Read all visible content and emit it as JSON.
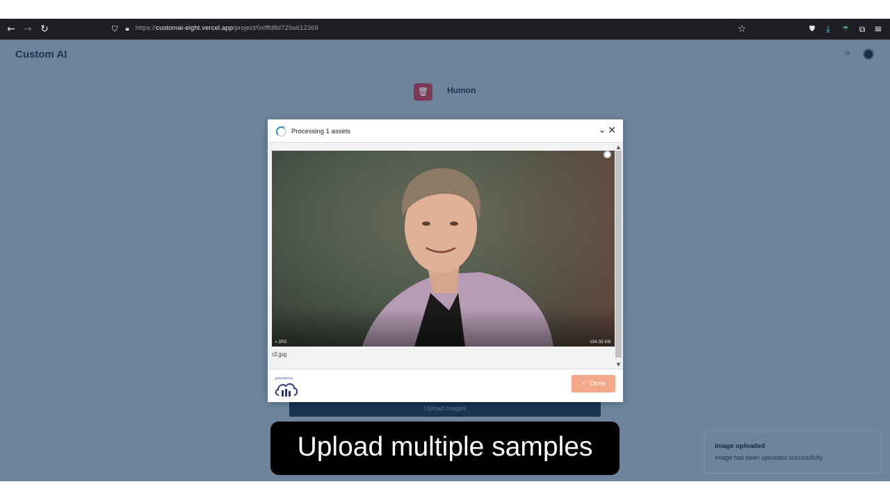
{
  "browser": {
    "url_prefix": "https://",
    "url_host": "customai-eight.vercel.app",
    "url_path": "/project/0xfffd8d729a612369"
  },
  "header": {
    "brand": "Custom AI"
  },
  "project": {
    "name": "Humon",
    "upload_button_label": "Upload Images"
  },
  "modal": {
    "status_text": "Processing 1 assets",
    "file": {
      "type": "JPG",
      "size": "104.05 KB",
      "name": "r2.jpg"
    },
    "footer": {
      "powered_by": "powered by",
      "done_label": "Done"
    }
  },
  "caption": "Upload multiple samples",
  "toast": {
    "title": "Image uploaded",
    "message": "Image has been uploaded successfully"
  },
  "colors": {
    "page_overlay": "#6e849d",
    "brand_text": "#1b3552",
    "done_button": "#f5a98b",
    "spinner_accent": "#2f86c8"
  }
}
